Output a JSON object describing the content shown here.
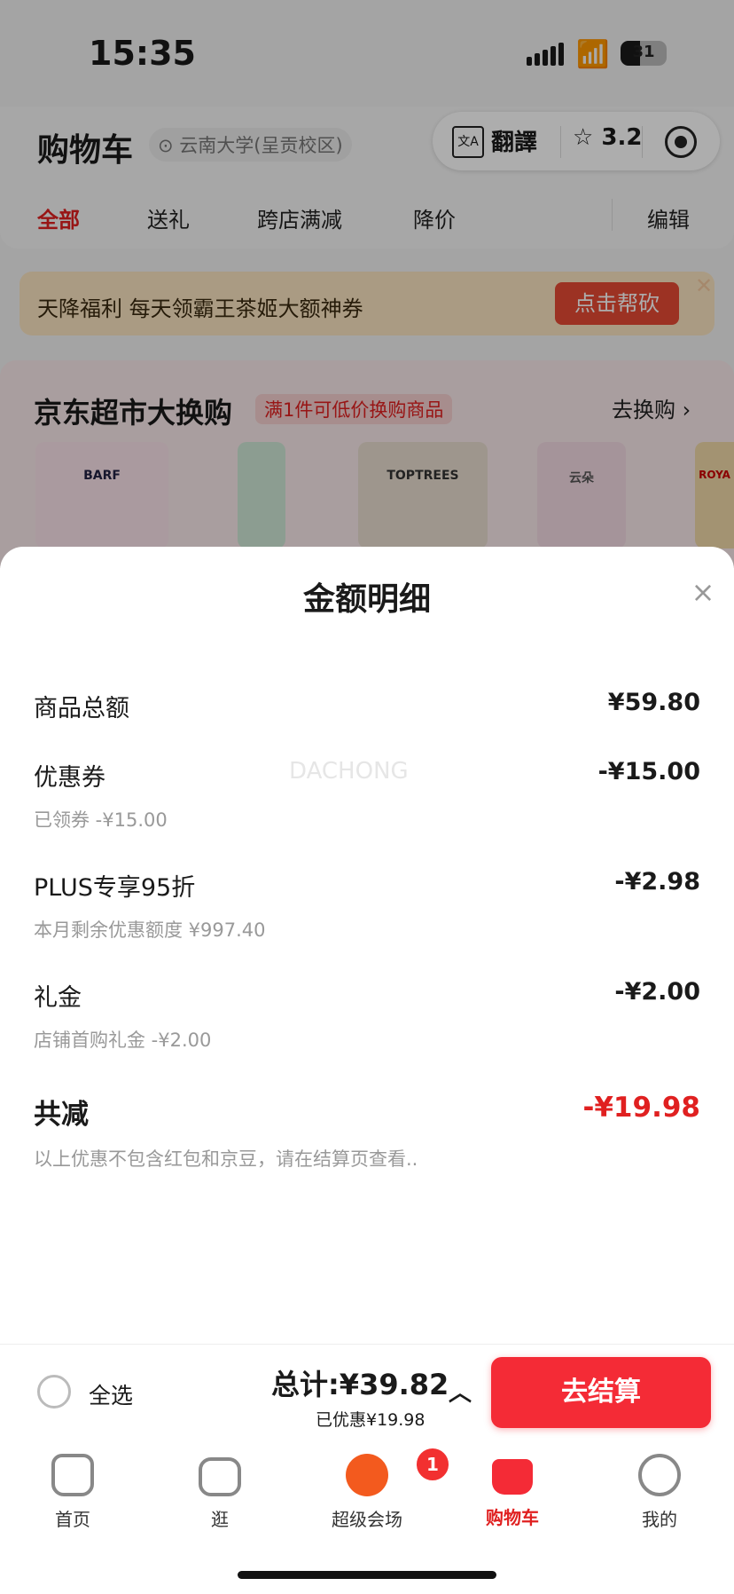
{
  "status_bar": {
    "time": "15:35",
    "battery": "31"
  },
  "header": {
    "title": "购物车",
    "location": "云南大学(呈贡校区)",
    "capsule": {
      "translate": "翻譯",
      "rating": "3.2"
    }
  },
  "tabs": [
    "全部",
    "送礼",
    "跨店满减",
    "降价",
    "编辑"
  ],
  "banner": {
    "text": "天降福利 每天领霸王茶姬大额神券",
    "button": "点击帮砍"
  },
  "promo": {
    "title": "京东超市大换购",
    "tag": "满1件可低价换购商品",
    "more": "去换购 ›",
    "products": [
      "BARF",
      "",
      "TOPTREES",
      "云朵",
      "ROYA"
    ]
  },
  "sheet": {
    "title": "金额明细",
    "watermark": "DACHONG",
    "rows": [
      {
        "label": "商品总额",
        "value": "¥59.80",
        "sub": ""
      },
      {
        "label": "优惠券",
        "value": "-¥15.00",
        "sub": "已领券 -¥15.00"
      },
      {
        "label": "PLUS专享95折",
        "value": "-¥2.98",
        "sub": "本月剩余优惠额度 ¥997.40"
      },
      {
        "label": "礼金",
        "value": "-¥2.00",
        "sub": "店铺首购礼金 -¥2.00"
      }
    ],
    "total_label": "共减",
    "total_value": "-¥19.98",
    "note": "以上优惠不包含红包和京豆，请在结算页查看.."
  },
  "checkout": {
    "select_all": "全选",
    "total": "总计:¥39.82",
    "saved": "已优惠¥19.98",
    "button": "去结算"
  },
  "tabbar": {
    "items": [
      {
        "label": "首页",
        "icon": "home-icon"
      },
      {
        "label": "逛",
        "icon": "video-icon"
      },
      {
        "label": "超级会场",
        "icon": "super-venue-icon",
        "badge": "1"
      },
      {
        "label": "购物车",
        "icon": "cart-icon"
      },
      {
        "label": "我的",
        "icon": "profile-icon"
      }
    ]
  },
  "colors": {
    "accent": "#e02020",
    "button": "#f42b36"
  }
}
